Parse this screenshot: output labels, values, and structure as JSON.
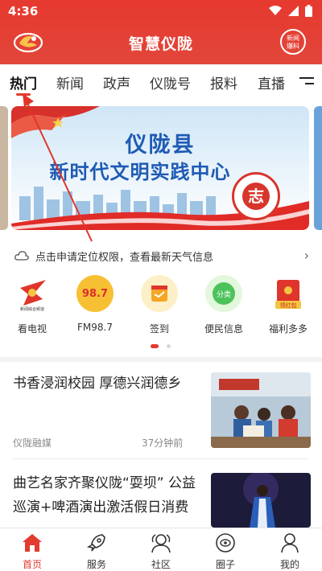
{
  "status_bar": {
    "time": "4:36"
  },
  "app_bar": {
    "title": "智慧仪陇",
    "news_button": [
      "新闻",
      "爆料"
    ]
  },
  "tabs": [
    {
      "label": "热门",
      "active": true
    },
    {
      "label": "新闻"
    },
    {
      "label": "政声"
    },
    {
      "label": "仪陇号"
    },
    {
      "label": "报料"
    },
    {
      "label": "直播"
    }
  ],
  "banner": {
    "line1": "仪陇县",
    "line2": "新时代文明实践中心",
    "seal_char": "志"
  },
  "weather": {
    "text": "点击申请定位权限，查看最新天气信息"
  },
  "quick_links": [
    {
      "label": "看电视",
      "icon": "tv-station-logo",
      "badge": "新闻综合频道"
    },
    {
      "label": "FM98.7",
      "icon": "radio-fm-logo",
      "badge": "98.7"
    },
    {
      "label": "签到",
      "icon": "checkin-calendar-icon"
    },
    {
      "label": "便民信息",
      "icon": "convenience-info-icon",
      "badge": "分类"
    },
    {
      "label": "福利多多",
      "icon": "red-envelope-icon",
      "badge": "领红包"
    }
  ],
  "news": [
    {
      "title": "书香浸润校园 厚德兴润德乡",
      "source": "仪陇融媒",
      "time": "37分钟前"
    },
    {
      "title": "曲艺名家齐聚仪陇“耍坝” 公益巡演+啤酒演出激活假日消费",
      "source": "",
      "time": ""
    }
  ],
  "bottom_nav": [
    {
      "label": "首页",
      "icon": "home-icon",
      "active": true
    },
    {
      "label": "服务",
      "icon": "rocket-icon"
    },
    {
      "label": "社区",
      "icon": "community-icon"
    },
    {
      "label": "圈子",
      "icon": "circle-icon"
    },
    {
      "label": "我的",
      "icon": "profile-icon"
    }
  ],
  "colors": {
    "brand_red": "#e23b30",
    "banner_blue": "#1f5bb4"
  }
}
